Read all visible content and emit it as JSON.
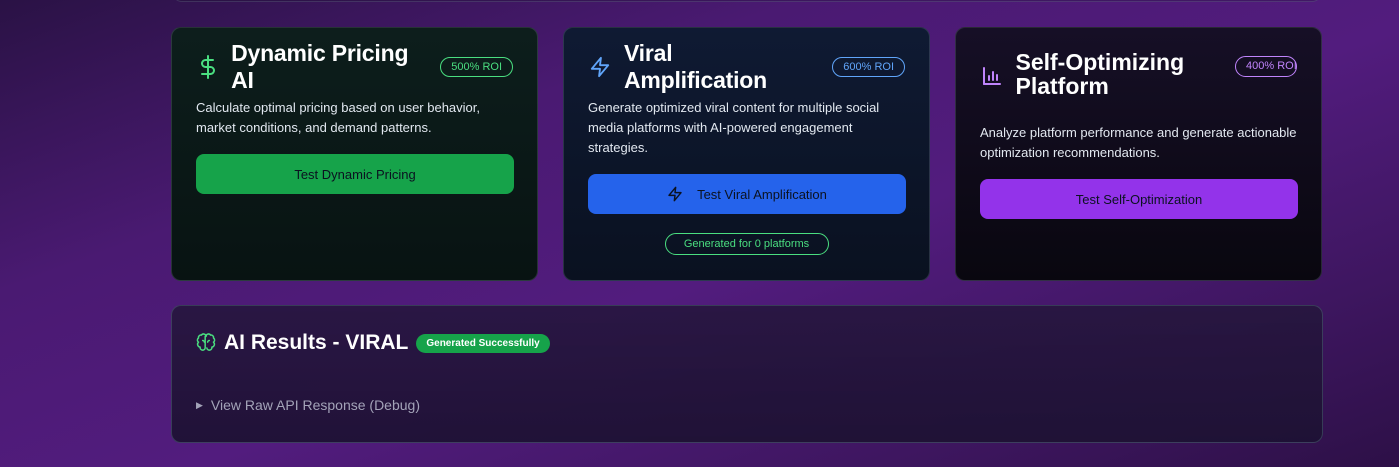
{
  "cards": {
    "pricing": {
      "title": "Dynamic Pricing AI",
      "roi": "500% ROI",
      "description": "Calculate optimal pricing based on user behavior, market conditions, and demand patterns.",
      "button_label": "Test Dynamic Pricing",
      "icon": "dollar-icon",
      "accent": "#16a34a"
    },
    "viral": {
      "title": "Viral Amplification",
      "roi": "600% ROI",
      "description": "Generate optimized viral content for multiple social media platforms with AI-powered engagement strategies.",
      "button_label": "Test Viral Amplification",
      "status_pill": "Generated for 0 platforms",
      "icon": "lightning-icon",
      "accent": "#2563eb"
    },
    "optim": {
      "title": "Self-Optimizing Platform",
      "roi": "400% ROI",
      "description": "Analyze platform performance and generate actionable optimization recommendations.",
      "button_label": "Test Self-Optimization",
      "icon": "bar-chart-icon",
      "accent": "#9333ea"
    }
  },
  "results": {
    "title": "AI Results - VIRAL",
    "badge": "Generated Successfully",
    "debug_label": "View Raw API Response (Debug)",
    "icon": "brain-icon"
  }
}
